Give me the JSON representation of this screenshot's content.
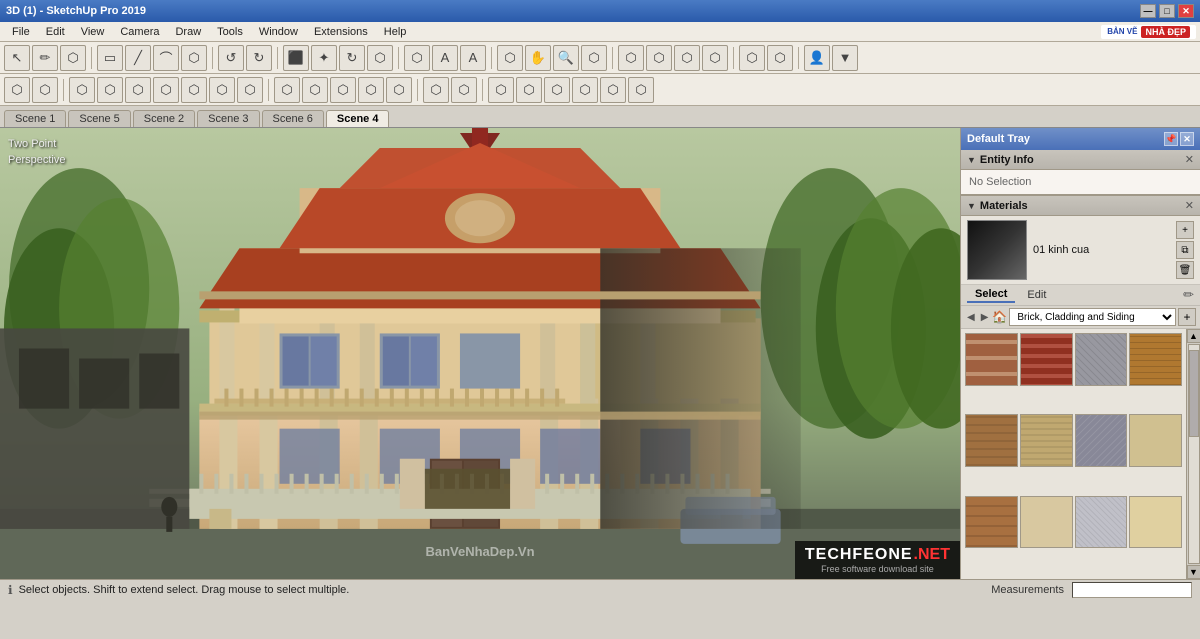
{
  "titleBar": {
    "title": "3D (1) - SketchUp Pro 2019",
    "minBtn": "—",
    "maxBtn": "□",
    "closeBtn": "✕"
  },
  "menuBar": {
    "items": [
      "File",
      "Edit",
      "View",
      "Camera",
      "Draw",
      "Tools",
      "Window",
      "Extensions",
      "Help"
    ]
  },
  "toolbar1": {
    "buttons": [
      "↖",
      "✏",
      "→",
      "○",
      "✦",
      "⬡",
      "↺",
      "↻",
      "⬛",
      "⬜",
      "⬡",
      "⬡",
      "⬡",
      "★",
      "A",
      "⬡",
      "⬡",
      "⬡",
      "⬡",
      "⬡",
      "⬡",
      "⬡",
      "⬡",
      "👤"
    ]
  },
  "toolbar2": {
    "buttons": [
      "⬡",
      "⬡",
      "⬡",
      "⬡",
      "⬡",
      "⬡",
      "⬡",
      "⬡",
      "⬡",
      "⬡",
      "⬡",
      "⬡",
      "⬡",
      "⬡",
      "⬡",
      "⬡",
      "⬡",
      "⬡",
      "⬡",
      "⬡",
      "⬡",
      "⬡",
      "⬡",
      "⬡",
      "⬡",
      "⬡"
    ]
  },
  "sceneTabs": {
    "tabs": [
      "Scene 1",
      "Scene 5",
      "Scene 2",
      "Scene 3",
      "Scene 6",
      "Scene 4"
    ],
    "activeTab": "Scene 4"
  },
  "viewport": {
    "labels": [
      "Two Point",
      "Perspective"
    ],
    "watermark": "BanVeNhaDep.Vn"
  },
  "rightPanel": {
    "trayTitle": "Default Tray",
    "entityInfo": {
      "sectionTitle": "Entity Info",
      "status": "No Selection"
    },
    "materials": {
      "sectionTitle": "Materials",
      "previewLabel": "01 kinh cua",
      "tabs": [
        "Select",
        "Edit"
      ],
      "activeTab": "Select",
      "category": "Brick, Cladding and Siding",
      "swatches": [
        {
          "color": "#c87840",
          "pattern": "brick"
        },
        {
          "color": "#c84830",
          "pattern": "brick2"
        },
        {
          "color": "#9898a0",
          "pattern": "stone"
        },
        {
          "color": "#c89040",
          "pattern": "wood"
        },
        {
          "color": "#a07840",
          "pattern": "brick3"
        },
        {
          "color": "#d0b080",
          "pattern": "siding"
        },
        {
          "color": "#808090",
          "pattern": "stone2"
        },
        {
          "color": "#d0c090",
          "pattern": "plaster"
        },
        {
          "color": "#a86840",
          "pattern": "brick4"
        },
        {
          "color": "#d8c8a0",
          "pattern": "stucco"
        },
        {
          "color": "#c0c0c8",
          "pattern": "concrete"
        },
        {
          "color": "#e8d8a0",
          "pattern": "plaster2"
        }
      ]
    }
  },
  "statusBar": {
    "message": "Select objects. Shift to extend select. Drag mouse to select multiple.",
    "measurementsLabel": "Measurements"
  },
  "logo": {
    "techfeone": "TECHFEONE",
    "net": ".NET",
    "sub": "Free software download site"
  },
  "topRightBrand": {
    "line1": "BẢN VẼ",
    "line2": "NHÀ ĐẸP"
  }
}
